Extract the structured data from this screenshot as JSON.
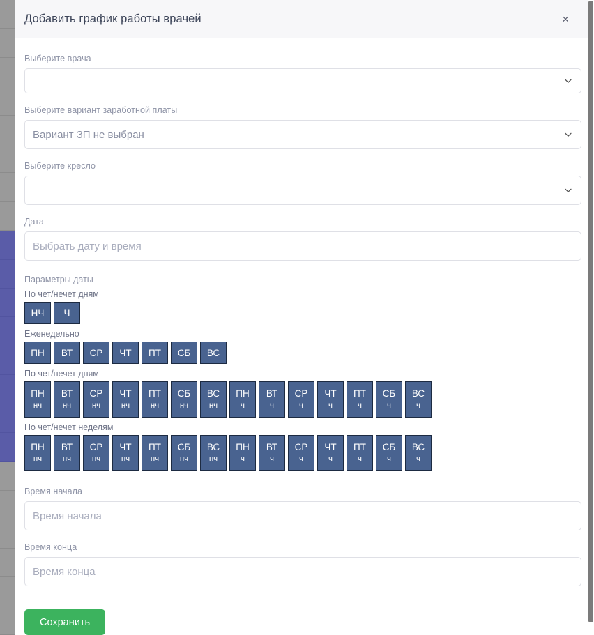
{
  "background": {
    "strip_segments": [
      {
        "kind": "grey"
      },
      {
        "kind": "grey"
      },
      {
        "kind": "grey"
      },
      {
        "kind": "grey"
      },
      {
        "kind": "grey"
      },
      {
        "kind": "grey"
      },
      {
        "kind": "grey"
      },
      {
        "kind": "grey"
      },
      {
        "kind": "accent"
      },
      {
        "kind": "accent"
      },
      {
        "kind": "accent"
      },
      {
        "kind": "accent"
      },
      {
        "kind": "accent"
      },
      {
        "kind": "accent"
      },
      {
        "kind": "accent"
      },
      {
        "kind": "accent"
      },
      {
        "kind": "grey"
      },
      {
        "kind": "grey"
      },
      {
        "kind": "grey"
      },
      {
        "kind": "grey"
      },
      {
        "kind": "grey"
      },
      {
        "kind": "grey"
      }
    ],
    "accent_color": "#5a5ca8",
    "grey_color": "#9a9a9a"
  },
  "modal": {
    "title": "Добавить график работы врачей",
    "close_label": "×"
  },
  "fields": {
    "doctor": {
      "label": "Выберите врача",
      "value": "",
      "icon": "chevron-down-icon"
    },
    "salary": {
      "label": "Выберите вариант заработной платы",
      "value": "Вариант ЗП не выбран",
      "icon": "chevron-down-icon"
    },
    "chair": {
      "label": "Выберите кресло",
      "value": "",
      "icon": "chevron-down-icon"
    },
    "date": {
      "label": "Дата",
      "placeholder": "Выбрать дату и время",
      "value": ""
    },
    "start_time": {
      "label": "Время начала",
      "placeholder": "Время начала",
      "value": ""
    },
    "end_time": {
      "label": "Время конца",
      "placeholder": "Время конца",
      "value": ""
    }
  },
  "date_params": {
    "title": "Параметры даты",
    "groups": [
      {
        "key": "parity_days_simple",
        "title": "По чет/нечет дням",
        "type": "one-line",
        "buttons": [
          {
            "l1": "НЧ"
          },
          {
            "l1": "Ч"
          }
        ]
      },
      {
        "key": "weekly",
        "title": "Еженедельно",
        "type": "one-line",
        "buttons": [
          {
            "l1": "ПН"
          },
          {
            "l1": "ВТ"
          },
          {
            "l1": "СР"
          },
          {
            "l1": "ЧТ"
          },
          {
            "l1": "ПТ"
          },
          {
            "l1": "СБ"
          },
          {
            "l1": "ВС"
          }
        ]
      },
      {
        "key": "parity_days",
        "title": "По чет/нечет дням",
        "type": "two-line",
        "buttons": [
          {
            "l1": "ПН",
            "l2": "нч"
          },
          {
            "l1": "ВТ",
            "l2": "нч"
          },
          {
            "l1": "СР",
            "l2": "нч"
          },
          {
            "l1": "ЧТ",
            "l2": "нч"
          },
          {
            "l1": "ПТ",
            "l2": "нч"
          },
          {
            "l1": "СБ",
            "l2": "нч"
          },
          {
            "l1": "ВС",
            "l2": "нч"
          },
          {
            "l1": "ПН",
            "l2": "ч"
          },
          {
            "l1": "ВТ",
            "l2": "ч"
          },
          {
            "l1": "СР",
            "l2": "ч"
          },
          {
            "l1": "ЧТ",
            "l2": "ч"
          },
          {
            "l1": "ПТ",
            "l2": "ч"
          },
          {
            "l1": "СБ",
            "l2": "ч"
          },
          {
            "l1": "ВС",
            "l2": "ч"
          }
        ]
      },
      {
        "key": "parity_weeks",
        "title": "По чет/нечет неделям",
        "type": "two-line",
        "buttons": [
          {
            "l1": "ПН",
            "l2": "нч"
          },
          {
            "l1": "ВТ",
            "l2": "нч"
          },
          {
            "l1": "СР",
            "l2": "нч"
          },
          {
            "l1": "ЧТ",
            "l2": "нч"
          },
          {
            "l1": "ПТ",
            "l2": "нч"
          },
          {
            "l1": "СБ",
            "l2": "нч"
          },
          {
            "l1": "ВС",
            "l2": "нч"
          },
          {
            "l1": "ПН",
            "l2": "ч"
          },
          {
            "l1": "ВТ",
            "l2": "ч"
          },
          {
            "l1": "СР",
            "l2": "ч"
          },
          {
            "l1": "ЧТ",
            "l2": "ч"
          },
          {
            "l1": "ПТ",
            "l2": "ч"
          },
          {
            "l1": "СБ",
            "l2": "ч"
          },
          {
            "l1": "ВС",
            "l2": "ч"
          }
        ]
      }
    ],
    "button_color": "#496390",
    "button_border_color": "#1d2b42",
    "button_text_color": "#ffffff"
  },
  "actions": {
    "save_label": "Сохранить",
    "save_color": "#3cb35e"
  },
  "scrollbar": {
    "thumb_color": "#7b7b7b"
  }
}
